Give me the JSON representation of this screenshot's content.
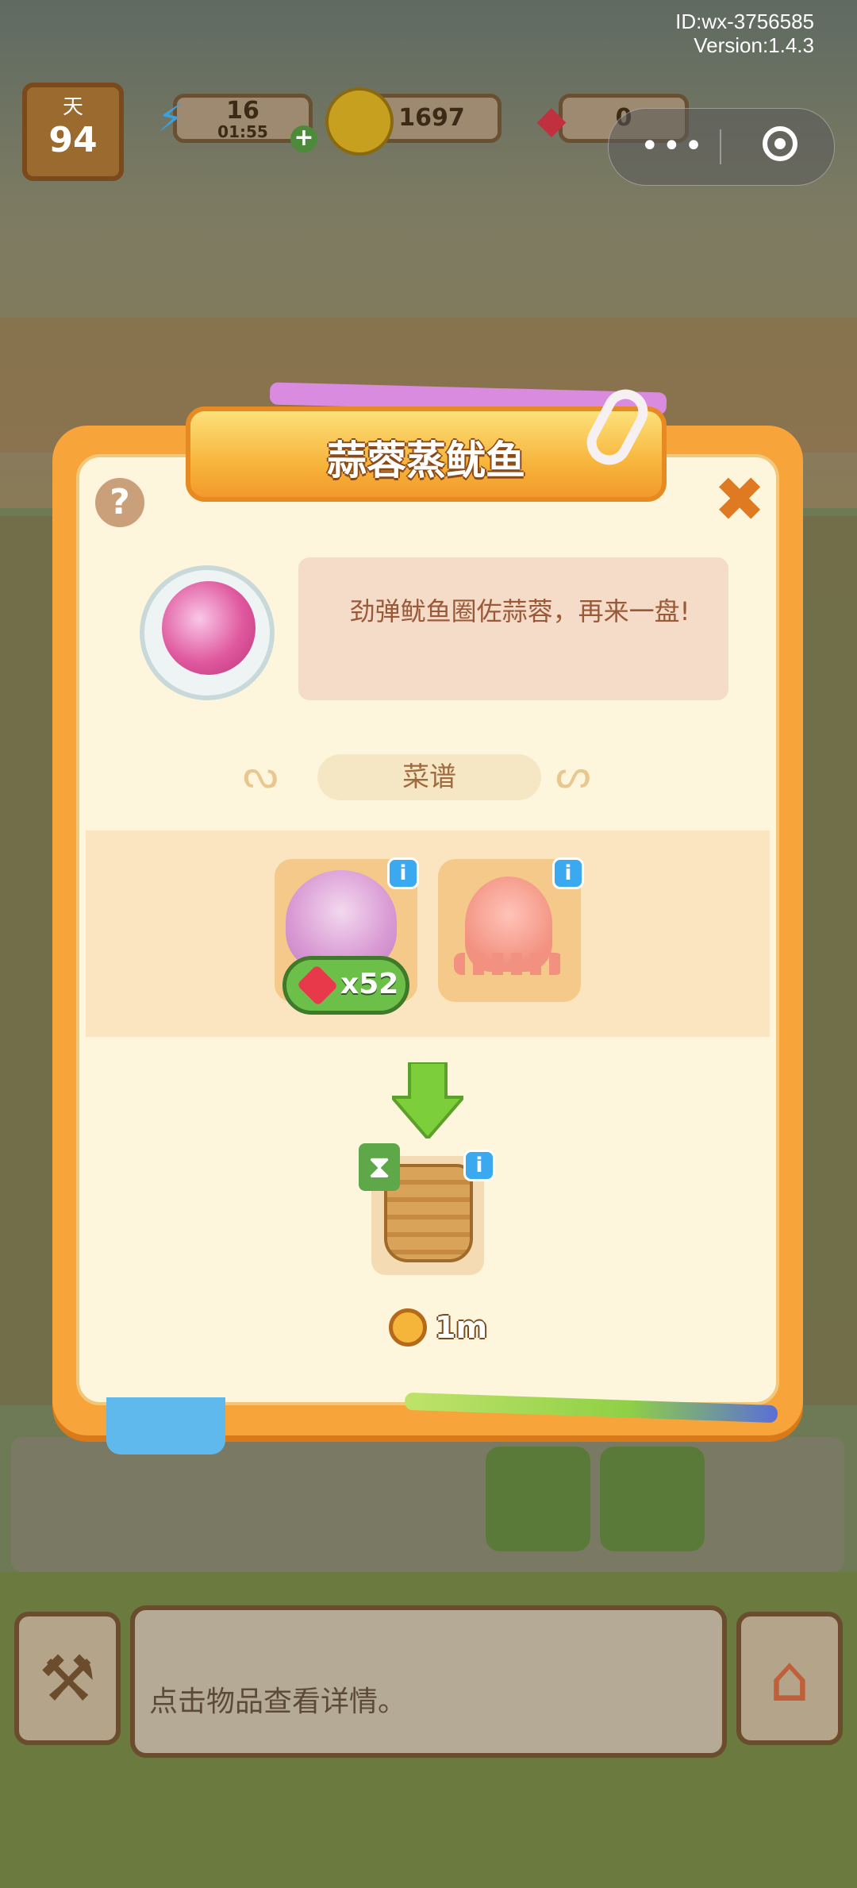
{
  "system": {
    "id_text": "ID:wx-3756585",
    "version_text": "Version:1.4.3"
  },
  "hud": {
    "day_label": "天",
    "day_value": "94",
    "energy_value": "16",
    "energy_timer": "01:55",
    "coins_value": "1697",
    "gems_value": "0"
  },
  "dialog": {
    "title": "蒜蓉蒸鱿鱼",
    "description": "劲弹鱿鱼圈佐蒜蓉，再来一盘!",
    "recipe_label": "菜谱",
    "ingredient_gem_cost": "x52",
    "cook_time": "1m",
    "help_label": "?",
    "close_label": "✖",
    "info_label": "i"
  },
  "footer": {
    "hint_text": "点击物品查看详情。"
  },
  "colors": {
    "dialog_frame": "#f7a43a",
    "dialog_body": "#fdf6dd",
    "description_text": "#9a5a3a",
    "gem_badge": "#6cc04a",
    "info_badge": "#3aa9ef"
  },
  "icons": {
    "help": "question-icon",
    "close": "close-x-icon",
    "garlic": "garlic-icon",
    "squid": "squid-icon",
    "steamer": "bamboo-steamer-icon",
    "gem": "ruby-gem-icon",
    "timer": "stopwatch-icon",
    "arrow": "arrow-down-icon"
  }
}
